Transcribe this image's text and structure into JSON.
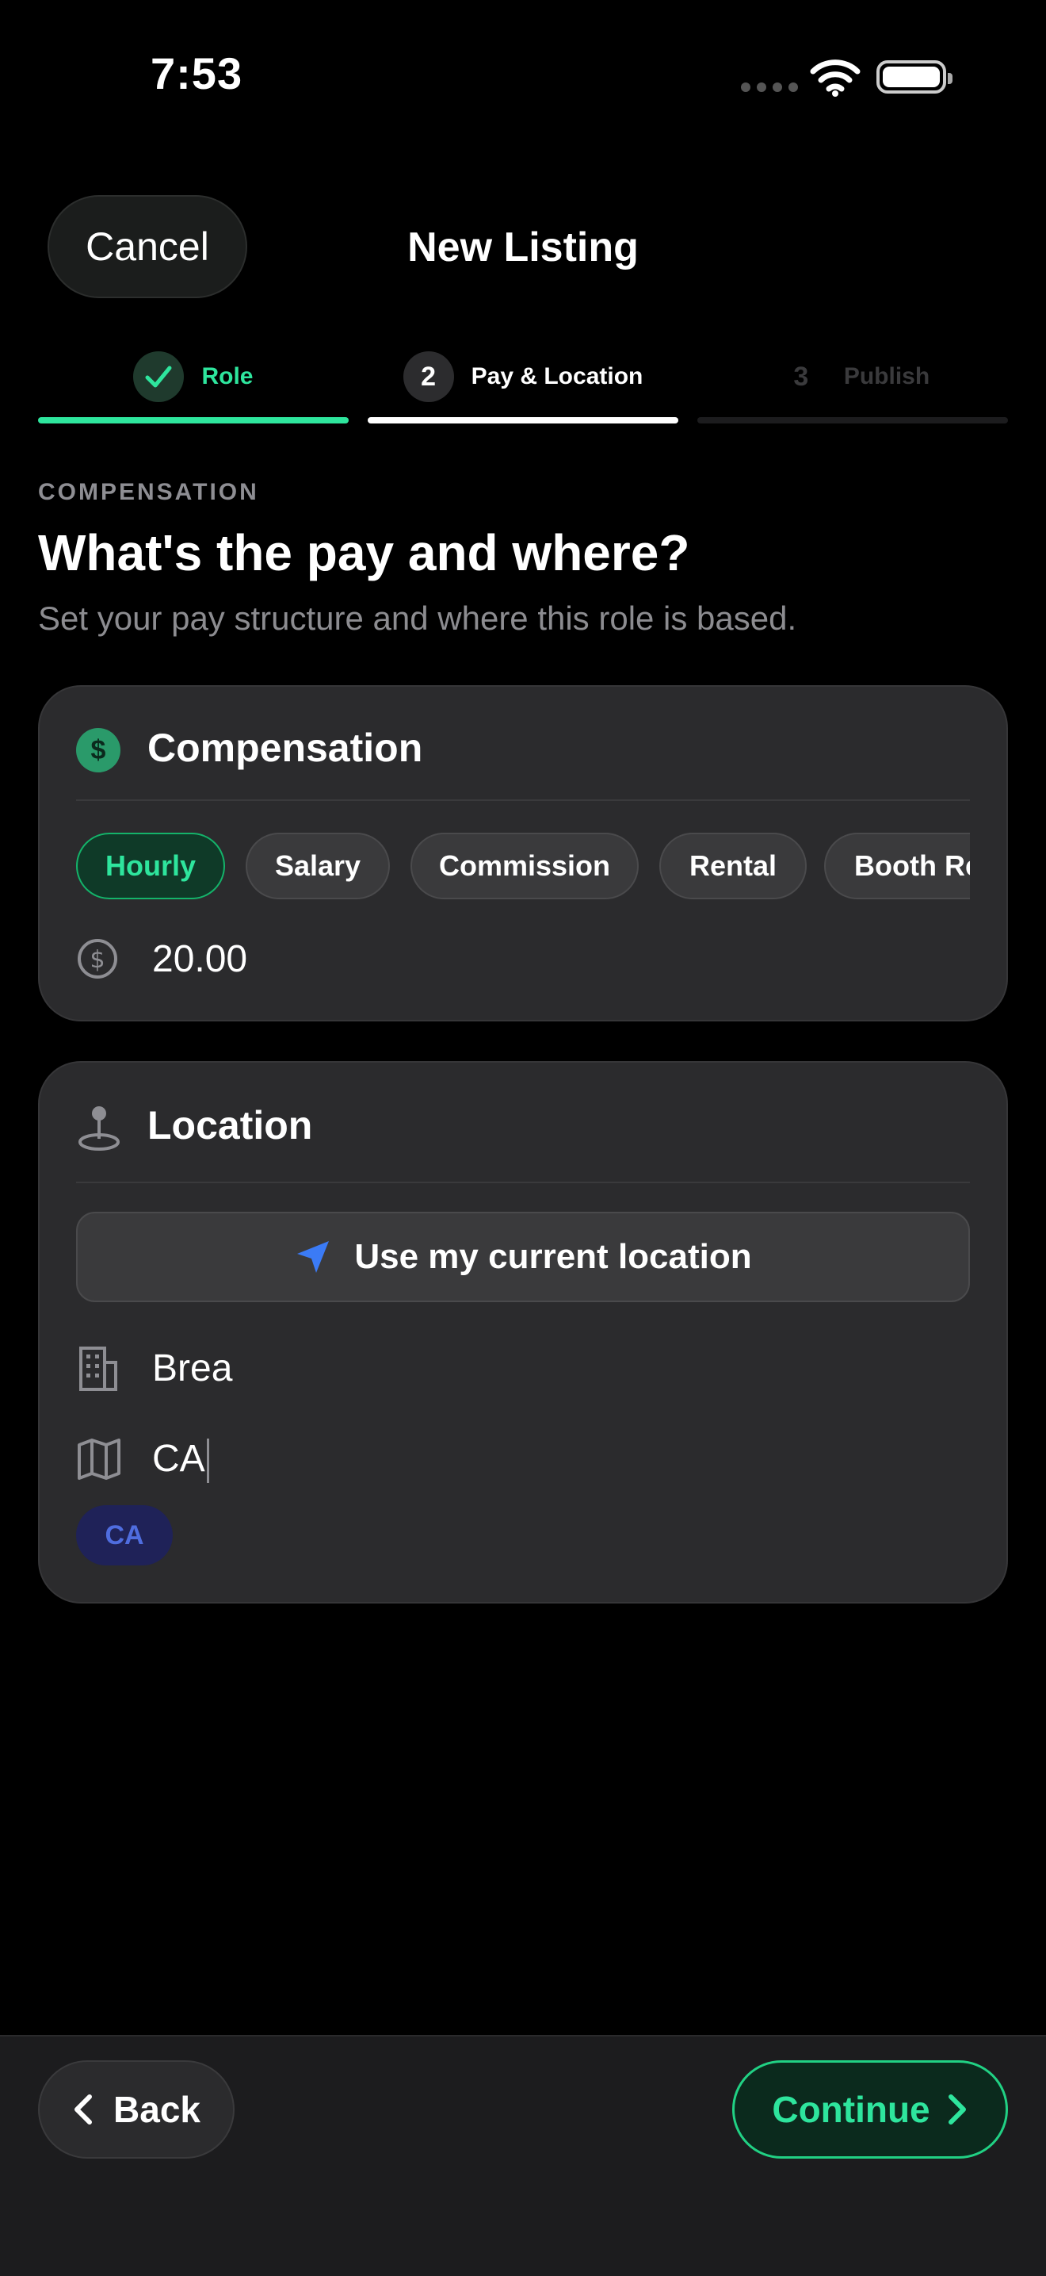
{
  "status_bar": {
    "time": "7:53"
  },
  "header": {
    "cancel_label": "Cancel",
    "title": "New Listing"
  },
  "steps": [
    {
      "number": "",
      "label": "Role",
      "state": "done"
    },
    {
      "number": "2",
      "label": "Pay & Location",
      "state": "current"
    },
    {
      "number": "3",
      "label": "Publish",
      "state": "upcoming"
    }
  ],
  "intro": {
    "eyebrow": "COMPENSATION",
    "heading": "What's the pay and where?",
    "subtitle": "Set your pay structure and where this role is based."
  },
  "compensation": {
    "title": "Compensation",
    "icon": "dollar-circle-icon",
    "pay_types": [
      "Hourly",
      "Salary",
      "Commission",
      "Rental",
      "Booth Rental"
    ],
    "selected": "Hourly",
    "amount": "20.00"
  },
  "location": {
    "title": "Location",
    "icon": "map-pin-icon",
    "use_current_label": "Use my current location",
    "city": "Brea",
    "state": "CA",
    "state_badge": "CA"
  },
  "footer": {
    "back_label": "Back",
    "continue_label": "Continue"
  },
  "colors": {
    "accent": "#2EE59D",
    "blue": "#3B7BF6",
    "card": "#2B2B2D"
  }
}
